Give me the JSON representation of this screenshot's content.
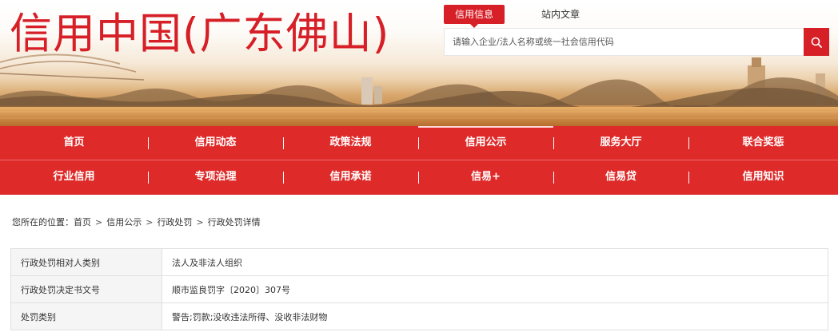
{
  "site": {
    "title": "信用中国(广东佛山)"
  },
  "search": {
    "tabs": [
      {
        "label": "信用信息",
        "active": true
      },
      {
        "label": "站内文章",
        "active": false
      }
    ],
    "placeholder": "请输入企业/法人名称或统一社会信用代码",
    "button_icon": "search-icon"
  },
  "nav": {
    "row1": [
      {
        "label": "首页"
      },
      {
        "label": "信用动态"
      },
      {
        "label": "政策法规"
      },
      {
        "label": "信用公示",
        "active": true
      },
      {
        "label": "服务大厅"
      },
      {
        "label": "联合奖惩"
      }
    ],
    "row2": [
      {
        "label": "行业信用"
      },
      {
        "label": "专项治理"
      },
      {
        "label": "信用承诺"
      },
      {
        "label": "信易+"
      },
      {
        "label": "信易贷"
      },
      {
        "label": "信用知识"
      }
    ]
  },
  "breadcrumb": {
    "prefix": "您所在的位置：",
    "items": [
      "首页",
      "信用公示",
      "行政处罚",
      "行政处罚详情"
    ],
    "separator": ">"
  },
  "details": [
    {
      "label": "行政处罚相对人类别",
      "value": "法人及非法人组织"
    },
    {
      "label": "行政处罚决定书文号",
      "value": "顺市监良罚字〔2020〕307号"
    },
    {
      "label": "处罚类别",
      "value": "警告;罚款;没收违法所得、没收非法财物"
    }
  ],
  "colors": {
    "brand_red": "#d61f26",
    "nav_red": "#de2a29"
  }
}
